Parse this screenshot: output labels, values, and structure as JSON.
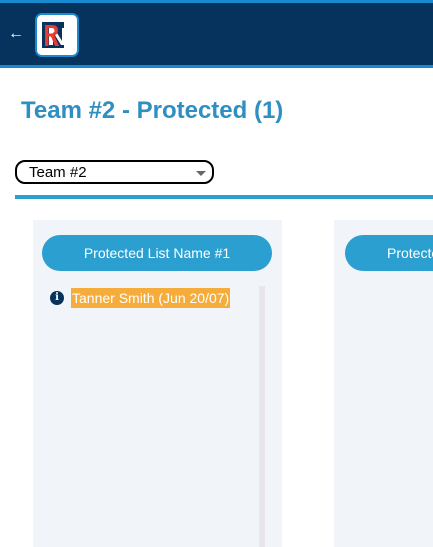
{
  "header": {
    "back_icon": "arrow-left-icon",
    "logo_icon": "bn-logo",
    "logo_text": "BN",
    "colors": {
      "background": "#06325e",
      "accent": "#1a8ad0"
    }
  },
  "page": {
    "title": "Team #2 - Protected (1)",
    "title_color": "#2f8fc0"
  },
  "team_select": {
    "selected": "Team #2"
  },
  "lists": [
    {
      "name": "Protected List Name #1",
      "players": [
        {
          "label": "Tanner Smith (Jun 20/07)",
          "icon": "info-icon",
          "highlight_color": "#f6ac3a"
        }
      ]
    },
    {
      "name": "Protecte",
      "players": []
    }
  ]
}
